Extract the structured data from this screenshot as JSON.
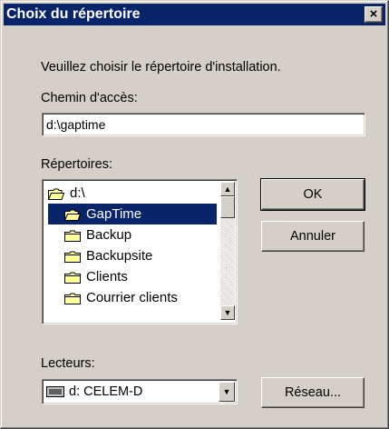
{
  "window": {
    "title": "Choix du répertoire",
    "close_label": "×"
  },
  "prompt": "Veuillez choisir le répertoire d'installation.",
  "path": {
    "label": "Chemin d'accès:",
    "value": "d:\\gaptime"
  },
  "directories": {
    "label": "Répertoires:",
    "items": [
      {
        "label": "d:\\",
        "icon": "open-folder-icon",
        "selected": false
      },
      {
        "label": "GapTime",
        "icon": "open-folder-icon",
        "selected": true
      },
      {
        "label": "Backup",
        "icon": "folder-icon",
        "selected": false
      },
      {
        "label": "Backupsite",
        "icon": "folder-icon",
        "selected": false
      },
      {
        "label": "Clients",
        "icon": "folder-icon",
        "selected": false
      },
      {
        "label": "Courrier clients",
        "icon": "folder-icon",
        "selected": false
      }
    ]
  },
  "buttons": {
    "ok": "OK",
    "cancel": "Annuler",
    "network": "Réseau..."
  },
  "drives": {
    "label": "Lecteurs:",
    "selected": "d: CELEM-D",
    "icon": "drive-icon"
  },
  "colors": {
    "title_bar": "#0a246a",
    "face": "#d4d0c8",
    "folder": "#ffff99"
  }
}
